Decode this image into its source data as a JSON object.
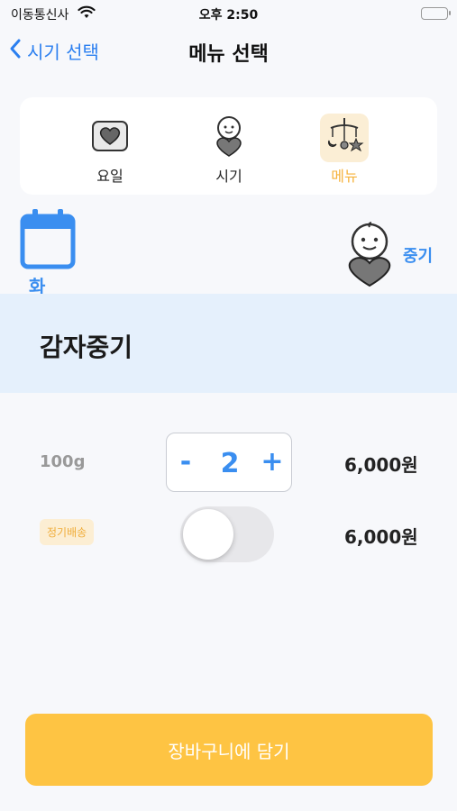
{
  "status_bar": {
    "carrier": "이동통신사",
    "time": "오후 2:50"
  },
  "nav": {
    "back_label": "시기 선택",
    "title": "메뉴 선택"
  },
  "steps": [
    {
      "label": "요일",
      "icon": "heart-box-icon",
      "active": false
    },
    {
      "label": "시기",
      "icon": "baby-heart-icon",
      "active": false
    },
    {
      "label": "메뉴",
      "icon": "mobile-toy-icon",
      "active": true
    }
  ],
  "selection": {
    "day": "화",
    "phase": "중기"
  },
  "menu": {
    "name": "감자중기"
  },
  "purchase": {
    "weight": "100g",
    "quantity": "2",
    "minus_label": "-",
    "plus_label": "+",
    "price": "6,000원",
    "subscription_badge": "정기배송",
    "subscription_enabled": false,
    "subscription_price": "6,000원"
  },
  "cart_button_label": "장바구니에 담기",
  "colors": {
    "accent_blue": "#3a8ef0",
    "accent_yellow": "#fec443",
    "banner_blue": "#e5f0fc"
  }
}
